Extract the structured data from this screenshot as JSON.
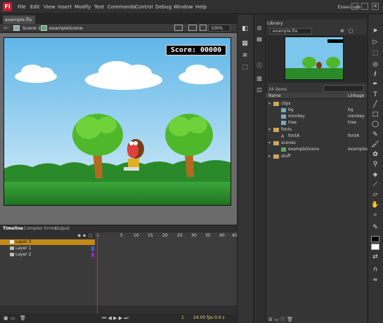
{
  "app": {
    "logo": "Fl"
  },
  "menu": [
    "File",
    "Edit",
    "View",
    "Insert",
    "Modify",
    "Text",
    "Commands",
    "Control",
    "Debug",
    "Window",
    "Help"
  ],
  "workspace": "Essentials",
  "document": {
    "tab": "example.fla",
    "scene": "Scene 1",
    "symbol": "exampleScene",
    "zoom": "100%"
  },
  "stage": {
    "score_label": "Score:",
    "score_value": "00000"
  },
  "timeline": {
    "tabs": [
      "Timeline",
      "Compiler Errors",
      "Output"
    ],
    "frame_numbers": [
      "1",
      "5",
      "10",
      "15",
      "20",
      "25",
      "30",
      "35",
      "40",
      "45"
    ],
    "layers": [
      {
        "name": "Layer 3",
        "color": "#c48a16",
        "selected": true
      },
      {
        "name": "Layer 1",
        "color": "#3060e8",
        "selected": false
      },
      {
        "name": "Layer 2",
        "color": "#a020d0",
        "selected": false
      }
    ],
    "current_frame": "1",
    "fps": "24.00 fps",
    "time": "0.0 s"
  },
  "library": {
    "title": "Library",
    "file": "example.fla",
    "count": "34 items",
    "col_name": "Name",
    "col_linkage": "Linkage",
    "items": [
      {
        "name": "clips",
        "linkage": "",
        "type": "folder",
        "depth": 0
      },
      {
        "name": "bg",
        "linkage": "bg",
        "type": "symbol",
        "depth": 1
      },
      {
        "name": "monkey",
        "linkage": "monkey",
        "type": "symbol",
        "depth": 1
      },
      {
        "name": "tree",
        "linkage": "tree",
        "type": "symbol",
        "depth": 1
      },
      {
        "name": "fonts",
        "linkage": "",
        "type": "folder",
        "depth": 0
      },
      {
        "name": "fontA",
        "linkage": "fontA",
        "type": "font",
        "depth": 1
      },
      {
        "name": "scenes",
        "linkage": "",
        "type": "folder",
        "depth": 0
      },
      {
        "name": "exampleScene",
        "linkage": "examples",
        "type": "symbol",
        "depth": 1
      },
      {
        "name": "stuff",
        "linkage": "",
        "type": "folder",
        "depth": 0
      }
    ]
  },
  "tools": [
    "selection-icon",
    "subselection-icon",
    "free-transform-icon",
    "3d-rotation-icon",
    "lasso-icon",
    "pen-icon",
    "text-icon",
    "line-icon",
    "rectangle-icon",
    "oval-icon",
    "pencil-icon",
    "brush-icon",
    "deco-icon",
    "bone-icon",
    "paint-bucket-icon",
    "eyedropper-icon",
    "eraser-icon",
    "hand-icon",
    "zoom-icon",
    "stroke-color-icon",
    "fill-color-icon"
  ]
}
